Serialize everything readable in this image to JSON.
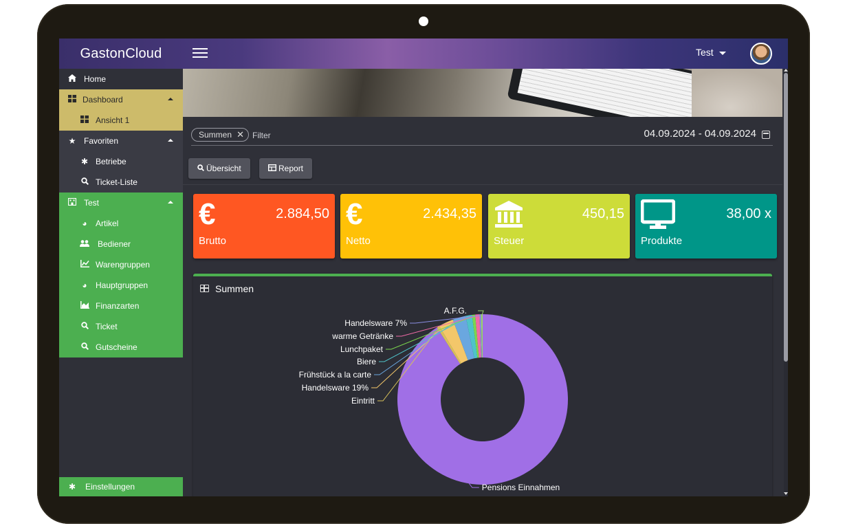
{
  "app": {
    "brand": "GastonCloud"
  },
  "user": {
    "name": "Test"
  },
  "sidebar": {
    "home": "Home",
    "dashboard": "Dashboard",
    "ansicht": "Ansicht 1",
    "favoriten": "Favoriten",
    "betriebe": "Betriebe",
    "ticket_liste": "Ticket-Liste",
    "test": "Test",
    "artikel": "Artikel",
    "bediener": "Bediener",
    "warengruppen": "Warengruppen",
    "hauptgruppen": "Hauptgruppen",
    "finanzarten": "Finanzarten",
    "ticket": "Ticket",
    "gutscheine": "Gutscheine",
    "einstellungen": "Einstellungen"
  },
  "filter": {
    "chip": "Summen",
    "chip_close": "✕",
    "label": "Filter",
    "date_range": "04.09.2024 - 04.09.2024"
  },
  "buttons": {
    "uebersicht": "Übersicht",
    "report": "Report"
  },
  "cards": [
    {
      "value": "2.884,50",
      "label": "Brutto",
      "color": "#ff5722",
      "icon": "euro-icon"
    },
    {
      "value": "2.434,35",
      "label": "Netto",
      "color": "#ffc107",
      "icon": "euro-icon"
    },
    {
      "value": "450,15",
      "label": "Steuer",
      "color": "#cddc39",
      "icon": "bank-icon"
    },
    {
      "value": "38,00 x",
      "label": "Produkte",
      "color": "#009688",
      "icon": "monitor-icon"
    }
  ],
  "panel": {
    "title": "Summen"
  },
  "colors": {
    "topbar_accent": "#8a5ea7",
    "sidebar_active": "#cdbb6a",
    "sidebar_group": "#4caf50"
  },
  "chart_data": {
    "type": "pie",
    "title": "",
    "donut": true,
    "slices": [
      {
        "label": "Pensions Einnahmen",
        "value": 91.0,
        "color": "#a06fe6"
      },
      {
        "label": "Eintritt",
        "value": 0.5,
        "color": "#d8c15a"
      },
      {
        "label": "Handelsware 19%",
        "value": 2.8,
        "color": "#f3c76a"
      },
      {
        "label": "Frühstück a la carte",
        "value": 2.5,
        "color": "#6aa7df"
      },
      {
        "label": "Biere",
        "value": 1.2,
        "color": "#4fc3c9"
      },
      {
        "label": "Lunchpaket",
        "value": 0.6,
        "color": "#7bd64e"
      },
      {
        "label": "warme Getränke",
        "value": 0.8,
        "color": "#f06aa6"
      },
      {
        "label": "Handelsware 7%",
        "value": 0.3,
        "color": "#8b8ee3"
      },
      {
        "label": "A.F.G.",
        "value": 0.3,
        "color": "#9ad46a"
      }
    ]
  }
}
